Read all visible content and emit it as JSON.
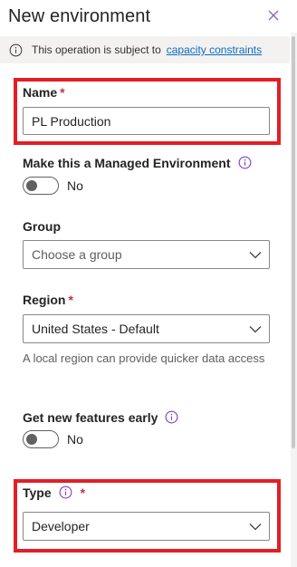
{
  "header": {
    "title": "New environment"
  },
  "infobar": {
    "text": "This operation is subject to",
    "link": "capacity constraints"
  },
  "name": {
    "label": "Name",
    "required_mark": "*",
    "value": "PL Production"
  },
  "managed": {
    "label": "Make this a Managed Environment",
    "toggle_text": "No",
    "checked": false
  },
  "group": {
    "label": "Group",
    "placeholder": "Choose a group"
  },
  "region": {
    "label": "Region",
    "required_mark": "*",
    "value": "United States - Default",
    "helper": "A local region can provide quicker data access"
  },
  "early": {
    "label": "Get new features early",
    "toggle_text": "No",
    "checked": false
  },
  "type": {
    "label": "Type",
    "required_mark": "*",
    "value": "Developer"
  },
  "colors": {
    "highlight": "#e21f26",
    "required": "#c4314b",
    "info_purple": "#7f3fbf",
    "link": "#0f6cbd"
  }
}
